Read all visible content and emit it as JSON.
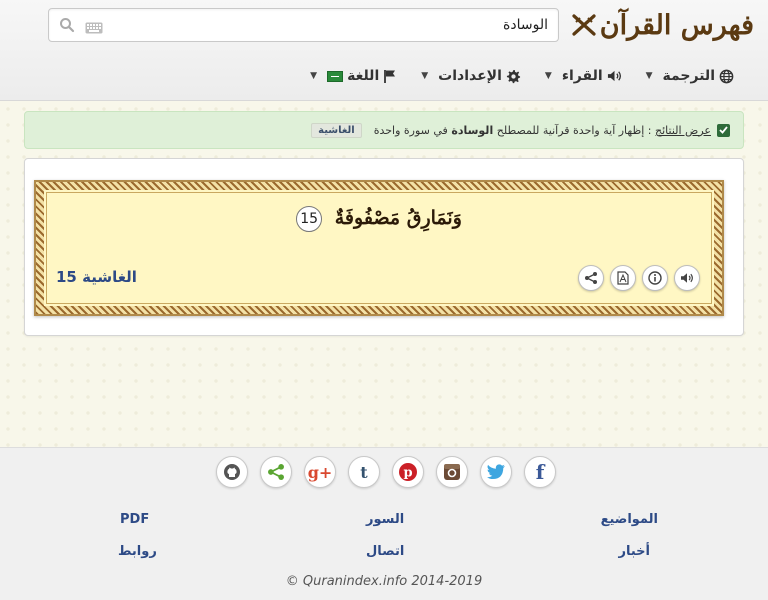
{
  "header": {
    "logo_text": "فهرس القرآن",
    "search": {
      "value": "الوسادة",
      "placeholder": ""
    },
    "nav": [
      {
        "label": "الترجمة",
        "icon": "globe-icon"
      },
      {
        "label": "القراء",
        "icon": "speaker-icon"
      },
      {
        "label": "الإعدادات",
        "icon": "gear-icon"
      },
      {
        "label": "اللغة",
        "icon": "flag-icon"
      }
    ]
  },
  "info_bar": {
    "link_text": "عرض النتائج",
    "text_before": " : إظهار آية واحدة قرآنية للمصطلح ",
    "term": "الوسادة",
    "text_after": " في سورة واحدة",
    "surah_tag": "الغاشية"
  },
  "verse": {
    "text": "وَنَمَارِقُ مَصْفُوفَةٌ",
    "number": "15",
    "reference": "الغاشية 15",
    "actions": [
      "audio-icon",
      "info-icon",
      "pdf-icon",
      "share-icon"
    ]
  },
  "footer": {
    "social": [
      "github-icon",
      "share-icon",
      "google-plus-icon",
      "tumblr-icon",
      "pinterest-icon",
      "instagram-icon",
      "twitter-icon",
      "facebook-icon"
    ],
    "links": {
      "topics": "المواضيع",
      "surahs": "السور",
      "pdf": "PDF",
      "news": "أخبار",
      "contact": "اتصال",
      "links": "روابط"
    },
    "copyright": "© Quranindex.info 2014-2019"
  },
  "colors": {
    "brand": "#5b3a12",
    "link": "#2d4a86",
    "info_bg": "#dff0d8",
    "verse_bg": "#fff7c4"
  }
}
